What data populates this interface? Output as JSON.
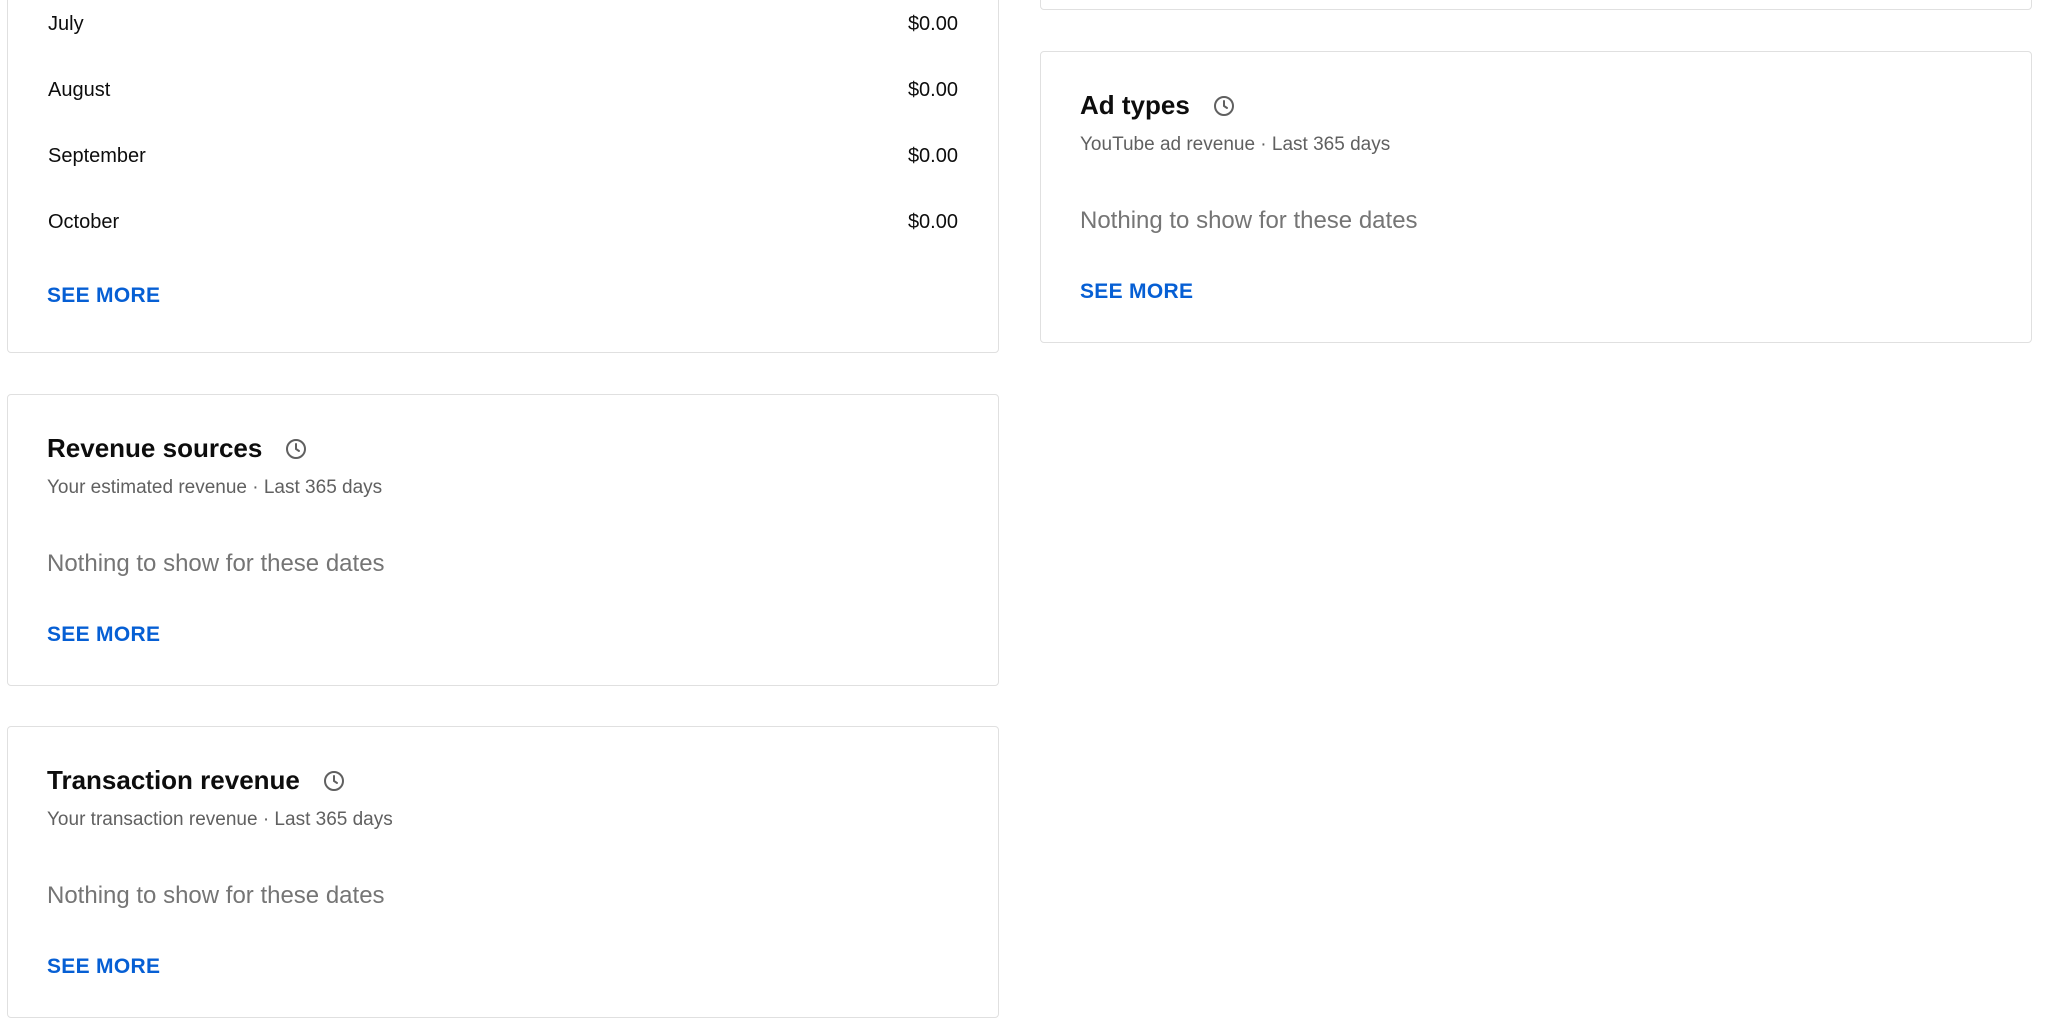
{
  "monthly_card": {
    "rows": [
      {
        "month": "July",
        "value": "$0.00"
      },
      {
        "month": "August",
        "value": "$0.00"
      },
      {
        "month": "September",
        "value": "$0.00"
      },
      {
        "month": "October",
        "value": "$0.00"
      }
    ],
    "see_more": "SEE MORE"
  },
  "revenue_sources": {
    "title": "Revenue sources",
    "subtitle": "Your estimated revenue · Last 365 days",
    "empty": "Nothing to show for these dates",
    "see_more": "SEE MORE"
  },
  "transaction_revenue": {
    "title": "Transaction revenue",
    "subtitle": "Your transaction revenue · Last 365 days",
    "empty": "Nothing to show for these dates",
    "see_more": "SEE MORE"
  },
  "ad_types": {
    "title": "Ad types",
    "subtitle": "YouTube ad revenue · Last 365 days",
    "empty": "Nothing to show for these dates",
    "see_more": "SEE MORE"
  },
  "icons": {
    "info_clock": "clock-icon"
  },
  "colors": {
    "link": "#065fd4",
    "border": "#e0e0e0",
    "muted_text": "#757575"
  }
}
